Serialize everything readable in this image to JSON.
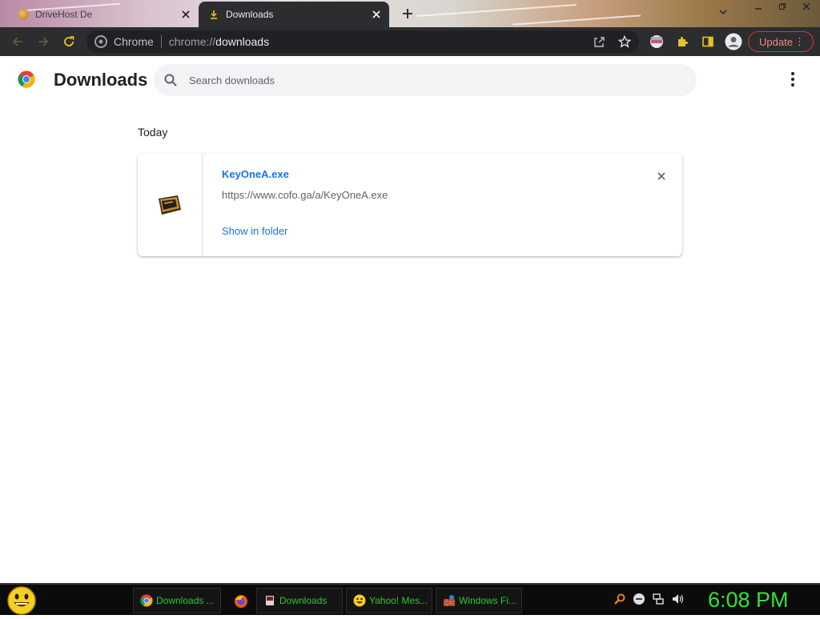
{
  "tabs": [
    {
      "title": "DriveHost De",
      "active": false
    },
    {
      "title": "Downloads",
      "active": true
    }
  ],
  "omnibox": {
    "site_label": "Chrome",
    "url_scheme": "chrome://",
    "url_path": "downloads"
  },
  "toolbar": {
    "update_label": "Update"
  },
  "page": {
    "title": "Downloads",
    "search_placeholder": "Search downloads",
    "search_value": ""
  },
  "downloads": {
    "section_date": "Today",
    "items": [
      {
        "file_name": "KeyOneA.exe",
        "url": "https://www.cofo.ga/a/KeyOneA.exe",
        "action_label": "Show in folder"
      }
    ]
  },
  "taskbar": {
    "tasks": [
      {
        "label": "Downloads ...",
        "icon": "chrome-icon"
      },
      {
        "label": "",
        "icon": "firefox-icon"
      },
      {
        "label": "Downloads",
        "icon": "downloads-app-icon"
      },
      {
        "label": "Yahoo! Mes...",
        "icon": "yahoo-messenger-icon"
      },
      {
        "label": "Windows Fi...",
        "icon": "windows-firewall-icon"
      }
    ],
    "clock": "6:08 PM"
  },
  "colors": {
    "accent": "#1a73e8",
    "taskbar_text": "#2ec82e",
    "update": "#e0332d"
  }
}
